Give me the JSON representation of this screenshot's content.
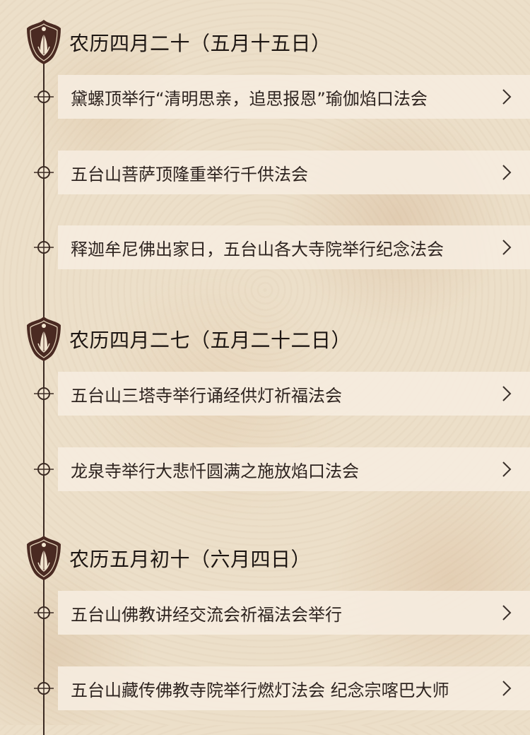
{
  "sections": [
    {
      "title": "农历四月二十（五月十五日）",
      "events": [
        {
          "label": "黛螺顶举行“清明思亲，追思报恩”瑜伽焰口法会"
        },
        {
          "label": "五台山菩萨顶隆重举行千供法会"
        },
        {
          "label": "释迦牟尼佛出家日，五台山各大寺院举行纪念法会"
        }
      ]
    },
    {
      "title": "农历四月二七（五月二十二日）",
      "events": [
        {
          "label": "五台山三塔寺举行诵经供灯祈福法会"
        },
        {
          "label": "龙泉寺举行大悲忏圆满之施放焰口法会"
        }
      ]
    },
    {
      "title": "农历五月初十（六月四日）",
      "events": [
        {
          "label": "五台山佛教讲经交流会祈福法会举行"
        },
        {
          "label": "五台山藏传佛教寺院举行燃灯法会 纪念宗喀巴大师"
        }
      ]
    }
  ],
  "icons": {
    "badge": "lotus-praying-hands-icon",
    "node": "crosshair-node-icon",
    "chevron": "chevron-right-icon"
  },
  "colors": {
    "badge_bg": "#4a2a22",
    "line": "#3b2a22",
    "row_bg": "#f5ecde",
    "text": "#2e2420"
  }
}
